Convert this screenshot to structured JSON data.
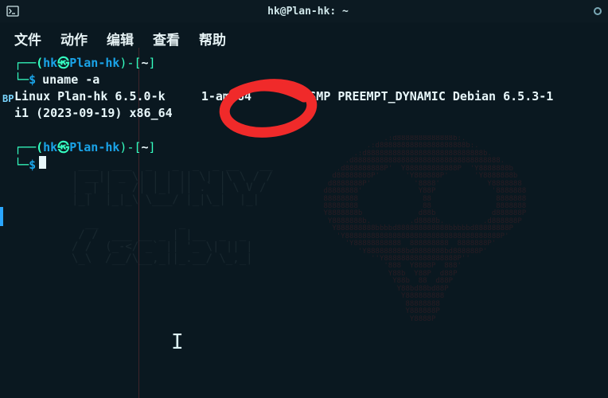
{
  "titlebar": {
    "title": "hk@Plan-hk: ~"
  },
  "menubar": {
    "file": "文件",
    "actions": "动作",
    "edit": "编辑",
    "view": "查看",
    "help": "帮助"
  },
  "prompt": {
    "open": "┌──(",
    "user": "hk",
    "at": "㉿",
    "host": "Plan-hk",
    "close": ")-[",
    "cwd": "~",
    "end": "]",
    "line2_prefix": "└─",
    "dollar": "$"
  },
  "command": "uname -a",
  "output_line1_a": "Linux Plan-hk 6.5.0-k",
  "output_line1_b": "1-amd64",
  "output_line1_c": "SMP PREEMPT_DYNAMIC Debian 6.5.3-1",
  "output_line2": "i1 (2023-09-19) x86_64",
  "left_badge": "BP",
  "annotation": {
    "circle_color": "#f02a2a"
  }
}
